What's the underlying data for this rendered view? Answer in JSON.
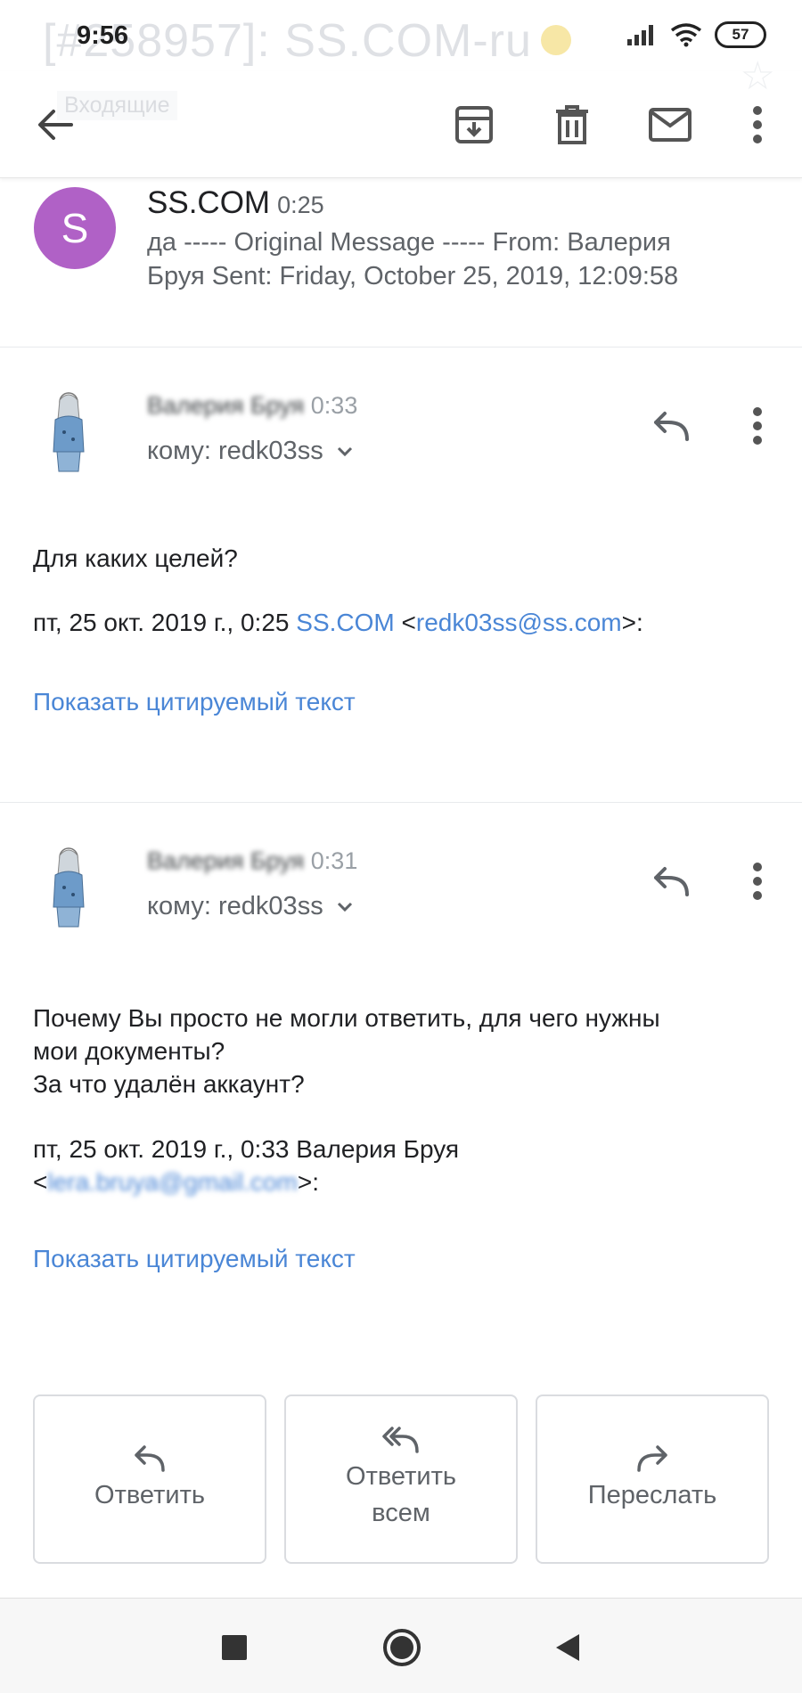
{
  "status_bar": {
    "time": "9:56",
    "battery": "57",
    "ghost_subject": "[#258957]: SS.COM-ru"
  },
  "toolbar": {
    "ghost_label": "Входящие",
    "icons": [
      "back-arrow-icon",
      "archive-icon",
      "trash-icon",
      "mail-icon",
      "more-vert-icon"
    ]
  },
  "thread_summary": {
    "avatar_letter": "S",
    "avatar_color": "#b061c6",
    "sender": "SS.COM",
    "time": "0:25",
    "line1": "да ----- Original Message ----- From: Валерия",
    "line2": "Бруя Sent: Friday, October 25, 2019, 12:09:58"
  },
  "messages": [
    {
      "sender_blurred": "Валерия Бруя",
      "time": "0:33",
      "to_label": "кому: redk03ss",
      "body": [
        "Для каких целей?"
      ],
      "quote_prefix": "пт, 25 окт. 2019 г., 0:25 ",
      "quote_name": "SS.COM",
      "quote_lt": " <",
      "quote_email": "redk03ss@ss.com",
      "quote_suffix": ">:",
      "show_quoted": "Показать цитируемый текст"
    },
    {
      "sender_blurred": "Валерия Бруя",
      "time": "0:31",
      "to_label": "кому: redk03ss",
      "body": [
        "Почему Вы просто не могли ответить, для чего нужны",
        "мои документы?",
        "За что удалён аккаунт?"
      ],
      "quote_prefix": "пт, 25 окт. 2019 г., 0:33 Валерия Бруя",
      "quote_email_blurred": "lera.bruya@gmail.com",
      "show_quoted": "Показать цитируемый текст"
    }
  ],
  "actions": {
    "reply": "Ответить",
    "reply_all_line1": "Ответить",
    "reply_all_line2": "всем",
    "forward": "Переслать"
  },
  "colors": {
    "link": "#4a86d6",
    "icon": "#5f6368"
  }
}
